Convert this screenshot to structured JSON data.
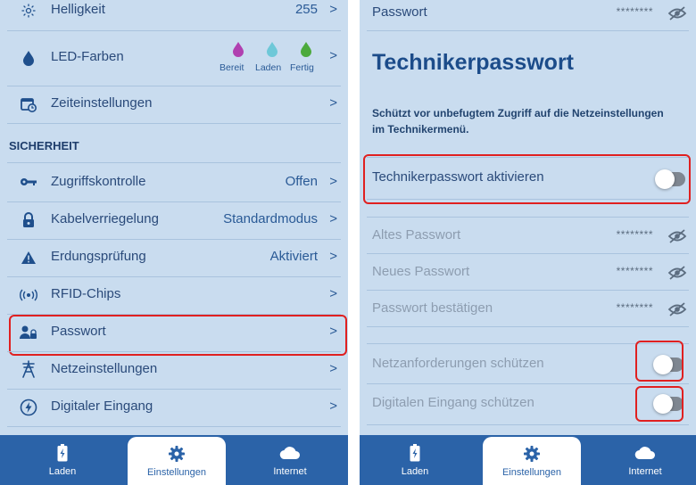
{
  "left": {
    "brightness": {
      "label": "Helligkeit",
      "value": "255"
    },
    "led_colors": {
      "label": "LED-Farben",
      "items": [
        {
          "label": "Bereit",
          "color": "#b040b0"
        },
        {
          "label": "Laden",
          "color": "#6ec8d8"
        },
        {
          "label": "Fertig",
          "color": "#4caa3c"
        }
      ]
    },
    "time_settings": {
      "label": "Zeiteinstellungen"
    },
    "section_security": "SICHERHEIT",
    "access_control": {
      "label": "Zugriffskontrolle",
      "value": "Offen"
    },
    "cable_lock": {
      "label": "Kabelverriegelung",
      "value": "Standardmodus"
    },
    "ground_check": {
      "label": "Erdungsprüfung",
      "value": "Aktiviert"
    },
    "rfid": {
      "label": "RFID-Chips"
    },
    "password": {
      "label": "Passwort"
    },
    "network": {
      "label": "Netzeinstellungen"
    },
    "digital_input": {
      "label": "Digitaler Eingang"
    }
  },
  "right": {
    "password_top": {
      "label": "Passwort",
      "value": "********"
    },
    "title": "Technikerpasswort",
    "description": "Schützt vor unbefugtem Zugriff auf die Netzeinstellungen im Technikermenü.",
    "activate": {
      "label": "Technikerpasswort aktivieren",
      "enabled": false
    },
    "old_pw": {
      "label": "Altes Passwort",
      "value": "********"
    },
    "new_pw": {
      "label": "Neues Passwort",
      "value": "********"
    },
    "confirm_pw": {
      "label": "Passwort bestätigen",
      "value": "********"
    },
    "protect_network": {
      "label": "Netzanforderungen schützen",
      "enabled": false
    },
    "protect_digital": {
      "label": "Digitalen Eingang schützen",
      "enabled": false
    }
  },
  "nav": {
    "charge": "Laden",
    "settings": "Einstellungen",
    "internet": "Internet"
  },
  "colors": {
    "background": "#c9dcef",
    "primary": "#2b63a8",
    "highlight": "#e02020",
    "text": "#2a4a7a"
  },
  "icons": [
    "sun-icon",
    "drop-icon",
    "calendar-clock-icon",
    "key-icon",
    "lock-icon",
    "warning-icon",
    "rfid-icon",
    "user-lock-icon",
    "tower-icon",
    "lightning-icon",
    "chevron-right-icon",
    "eye-off-icon",
    "battery-icon",
    "gear-icon",
    "cloud-icon"
  ]
}
